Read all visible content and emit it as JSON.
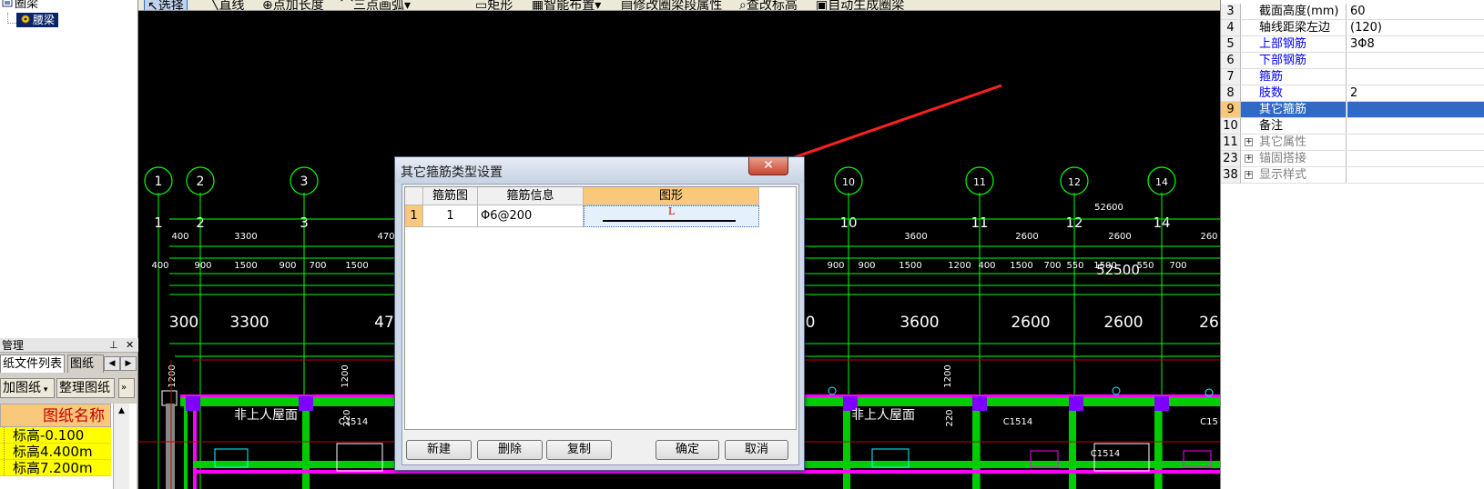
{
  "tree": {
    "root_label": "圈梁",
    "selected_label": "腰梁"
  },
  "drawing_manager": {
    "title": "管理",
    "tab_files": "纸文件列表",
    "tab_other": "图纸楼",
    "btn_add": "加图纸",
    "btn_organize": "整理图纸",
    "column_header": "图纸名称",
    "rows": [
      "标高-0.100",
      "标高4.400m",
      "标高7.200m"
    ]
  },
  "toolbar": {
    "items": [
      "选择",
      "直线",
      "点加长度",
      "三点画弧",
      "矩形",
      "智能布置",
      "修改圈梁段属性",
      "查改标高",
      "自动生成圈梁"
    ]
  },
  "canvas": {
    "axes_top": [
      "1",
      "2",
      "3",
      "10",
      "11",
      "12",
      "14"
    ],
    "axes_row": [
      "1",
      "2",
      "3",
      "10",
      "11",
      "12",
      "14"
    ],
    "total_dim": "52600",
    "dim_row1_left": [
      "400",
      "3300",
      "470"
    ],
    "dim_row1_right": [
      "3600",
      "2600",
      "2600",
      "260"
    ],
    "dim_row2_left": [
      "400",
      "900",
      "1500",
      "900",
      "700",
      "1500"
    ],
    "dim_row2_right": [
      "900",
      "900",
      "1500",
      "1200",
      "400",
      "1500",
      "700",
      "550",
      "1500",
      "550",
      "700"
    ],
    "big_dim": "52500",
    "big_left": [
      "300",
      "3300",
      "47"
    ],
    "big_right": [
      "0",
      "3600",
      "2600",
      "2600",
      "26"
    ],
    "vert_dims": [
      "1200",
      "1200",
      "220",
      "1200",
      "220"
    ],
    "room_labels": [
      "非上人屋面",
      "非上人屋面"
    ],
    "window_labels": [
      "C1514",
      "C1514",
      "C1514",
      "C15"
    ]
  },
  "properties": {
    "rows": [
      {
        "num": "3",
        "name": "截面高度(mm)",
        "value": "60",
        "style": ""
      },
      {
        "num": "4",
        "name": "轴线距梁左边",
        "value": "(120)",
        "style": ""
      },
      {
        "num": "5",
        "name": "上部钢筋",
        "value": "3Φ8",
        "style": "blue"
      },
      {
        "num": "6",
        "name": "下部钢筋",
        "value": "",
        "style": "blue"
      },
      {
        "num": "7",
        "name": "箍筋",
        "value": "",
        "style": "blue"
      },
      {
        "num": "8",
        "name": "肢数",
        "value": "2",
        "style": "blue"
      },
      {
        "num": "9",
        "name": "其它箍筋",
        "value": "",
        "style": "selected"
      },
      {
        "num": "10",
        "name": "备注",
        "value": "",
        "style": ""
      },
      {
        "num": "11",
        "name": "其它属性",
        "value": "",
        "style": "gray-plus"
      },
      {
        "num": "23",
        "name": "锚固搭接",
        "value": "",
        "style": "gray-plus"
      },
      {
        "num": "38",
        "name": "显示样式",
        "value": "",
        "style": "gray-plus"
      }
    ]
  },
  "dialog": {
    "title": "其它箍筋类型设置",
    "close": "✕",
    "columns": [
      "箍筋图",
      "箍筋信息",
      "图形"
    ],
    "rows": [
      {
        "row_num": "1",
        "figure_no": "1",
        "info": "Φ6@200",
        "shape_label": "L"
      }
    ],
    "buttons": {
      "new": "新建",
      "delete": "删除",
      "copy": "复制",
      "ok": "确定",
      "cancel": "取消"
    }
  },
  "colors": {
    "axis_line": "#00ff00",
    "axis_circle": "#00ff00",
    "dim_text": "#ffffff",
    "wall_magenta": "#ff00ff",
    "annotation_arrow": "#ff2020",
    "selection": "#316ac5",
    "header_orange": "#f9c87a"
  }
}
